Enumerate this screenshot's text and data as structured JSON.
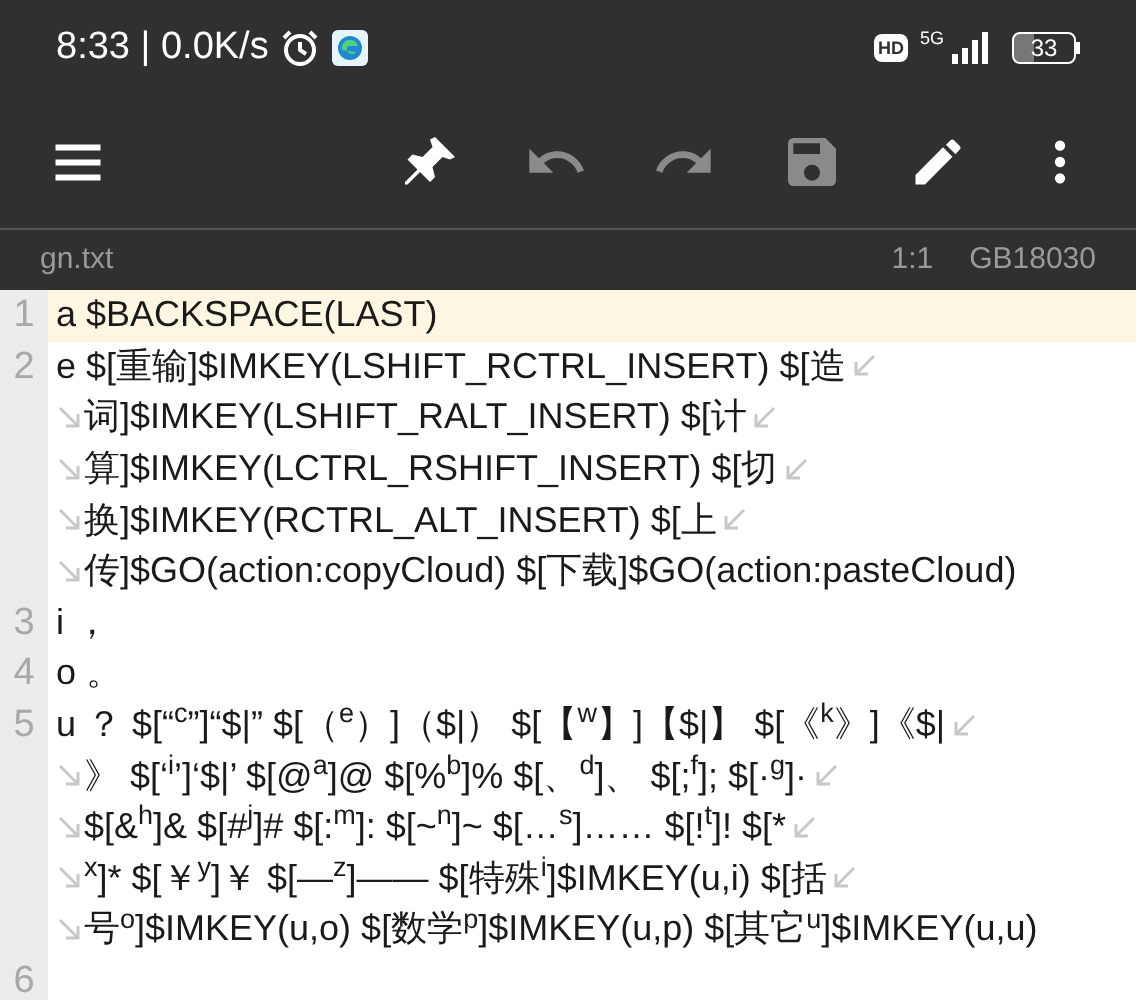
{
  "status_bar": {
    "time": "8:33 | 0.0K/s",
    "hd": "HD",
    "network": "5G",
    "battery": "33"
  },
  "toolbar": [
    {
      "kind": "menu",
      "disabled": false
    },
    {
      "kind": "pin",
      "disabled": false
    },
    {
      "kind": "undo",
      "disabled": true
    },
    {
      "kind": "redo",
      "disabled": true
    },
    {
      "kind": "save",
      "disabled": true
    },
    {
      "kind": "edit",
      "disabled": false
    },
    {
      "kind": "more",
      "disabled": false
    }
  ],
  "file_bar": {
    "filename": "gn.txt",
    "position": "1:1",
    "encoding": "GB18030"
  },
  "lines": [
    {
      "number": "1",
      "current": true,
      "rows": [
        "a  $BACKSPACE(LAST)"
      ]
    },
    {
      "number": "2",
      "current": false,
      "rows": [
        "e  $[重输]$IMKEY(LSHIFT_RCTRL_INSERT)  $[造",
        "词]$IMKEY(LSHIFT_RALT_INSERT)  $[计",
        "算]$IMKEY(LCTRL_RSHIFT_INSERT)  $[切",
        "换]$IMKEY(RCTRL_ALT_INSERT)  $[上",
        "传]$GO(action:copyCloud)  $[下载]$GO(action:pasteCloud)"
      ]
    },
    {
      "number": "3",
      "current": false,
      "rows": [
        "i  ，"
      ]
    },
    {
      "number": "4",
      "current": false,
      "rows": [
        "o  。"
      ]
    },
    {
      "number": "5",
      "current": false,
      "rows": [
        "u  ？  $[“$^{c}$”]“$|”  $[（$^{e}$）]（$|）  $[【$^{w}$】]【$|】  $[《$^{k}$》]《$|",
        "》  $[‘$^{i}$’]‘$|’  $[@$^{a}$]@  $[%$^{b}$]%  $[、$^{d}$]、  $[;$^{f}$];  $[·$^{g}$]·",
        "$[&$^{h}$]&  $[#$^{j}$]#  $[:$^{m}$]:  $[~$^{n}$]~  $[…$^{s}$]……  $[!$^{t}$]!  $[*",
        "$^{x}$]*  $[￥$^{y}$]￥  $[—$^{z}$]——  $[特殊$^{i}$]$IMKEY(u,i)  $[括",
        "号$^{o}$]$IMKEY(u,o)  $[数学$^{p}$]$IMKEY(u,p)  $[其它$^{u}$]$IMKEY(u,u)"
      ]
    },
    {
      "number": "6",
      "current": false
    }
  ]
}
